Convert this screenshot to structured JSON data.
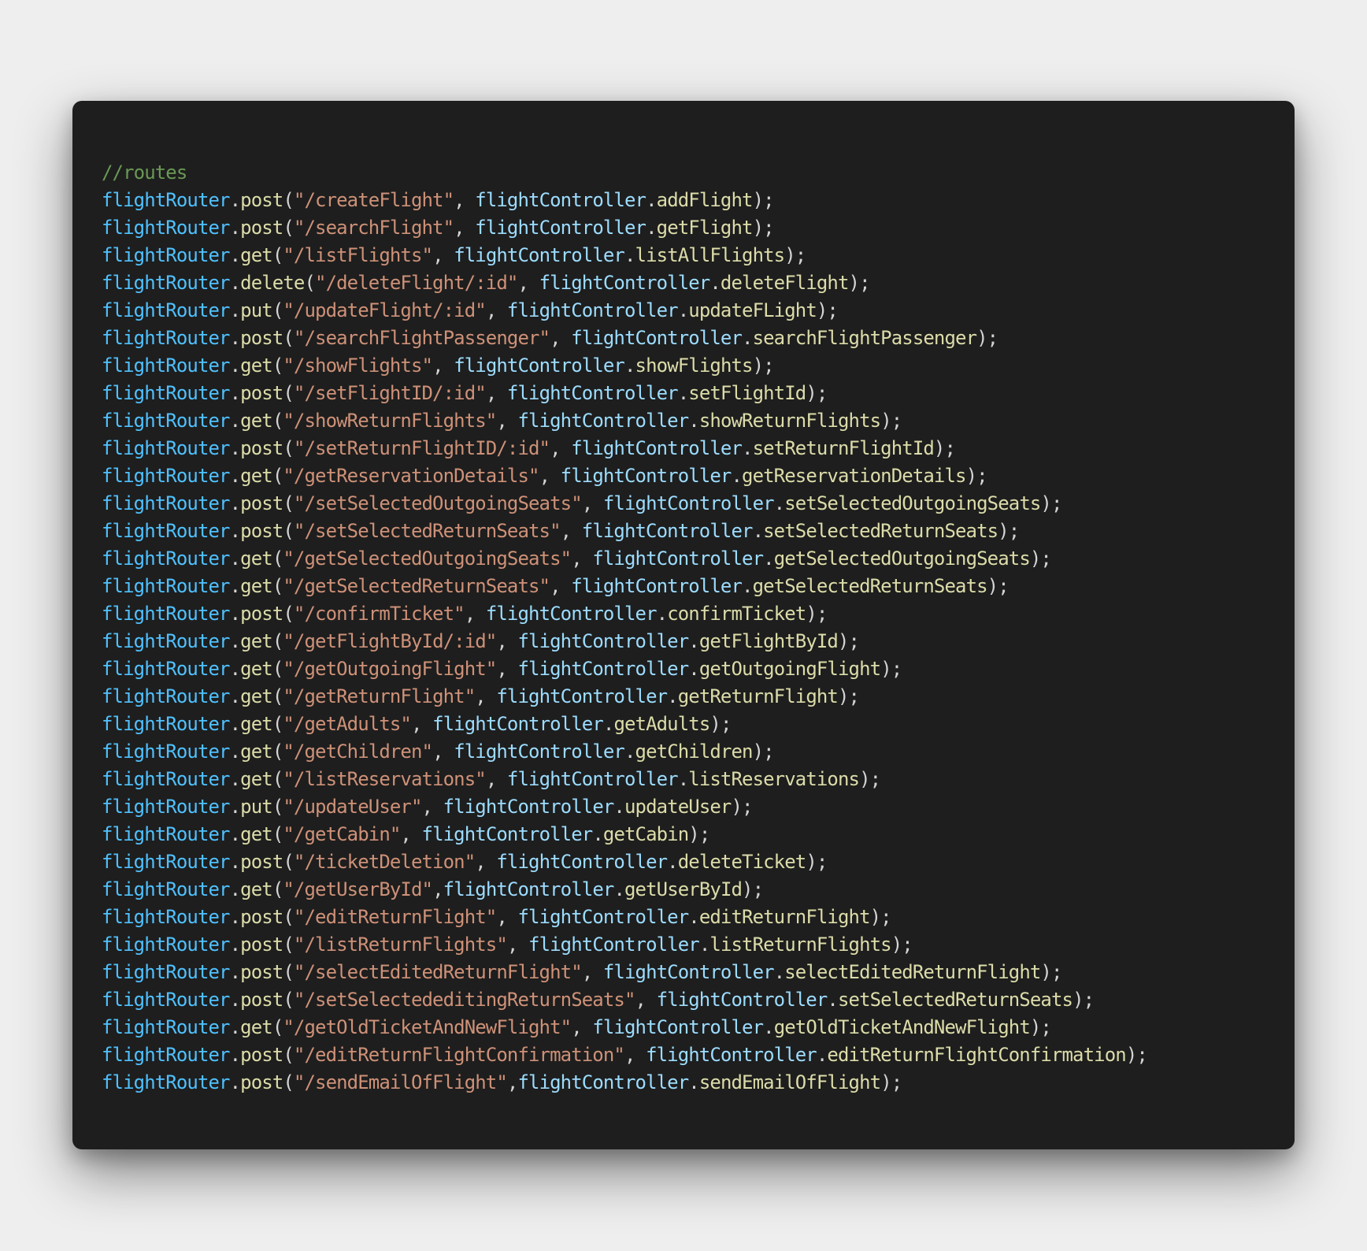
{
  "code": {
    "comment": "//routes",
    "router": "flightRouter",
    "controller": "flightController",
    "routes": [
      {
        "method": "post",
        "path": "\"/createFlight\"",
        "sep": ", ",
        "handler": "addFlight"
      },
      {
        "method": "post",
        "path": "\"/searchFlight\"",
        "sep": ", ",
        "handler": "getFlight"
      },
      {
        "method": "get",
        "path": "\"/listFlights\"",
        "sep": ", ",
        "handler": "listAllFlights"
      },
      {
        "method": "delete",
        "path": "\"/deleteFlight/:id\"",
        "sep": ", ",
        "handler": "deleteFlight"
      },
      {
        "method": "put",
        "path": "\"/updateFlight/:id\"",
        "sep": ", ",
        "handler": "updateFLight"
      },
      {
        "method": "post",
        "path": "\"/searchFlightPassenger\"",
        "sep": ", ",
        "handler": "searchFlightPassenger"
      },
      {
        "method": "get",
        "path": "\"/showFlights\"",
        "sep": ", ",
        "handler": "showFlights"
      },
      {
        "method": "post",
        "path": "\"/setFlightID/:id\"",
        "sep": ", ",
        "handler": "setFlightId"
      },
      {
        "method": "get",
        "path": "\"/showReturnFlights\"",
        "sep": ", ",
        "handler": "showReturnFlights"
      },
      {
        "method": "post",
        "path": "\"/setReturnFlightID/:id\"",
        "sep": ", ",
        "handler": "setReturnFlightId"
      },
      {
        "method": "get",
        "path": "\"/getReservationDetails\"",
        "sep": ", ",
        "handler": "getReservationDetails"
      },
      {
        "method": "post",
        "path": "\"/setSelectedOutgoingSeats\"",
        "sep": ", ",
        "handler": "setSelectedOutgoingSeats"
      },
      {
        "method": "post",
        "path": "\"/setSelectedReturnSeats\"",
        "sep": ", ",
        "handler": "setSelectedReturnSeats"
      },
      {
        "method": "get",
        "path": "\"/getSelectedOutgoingSeats\"",
        "sep": ", ",
        "handler": "getSelectedOutgoingSeats"
      },
      {
        "method": "get",
        "path": "\"/getSelectedReturnSeats\"",
        "sep": ", ",
        "handler": "getSelectedReturnSeats"
      },
      {
        "method": "post",
        "path": "\"/confirmTicket\"",
        "sep": ", ",
        "handler": "confirmTicket"
      },
      {
        "method": "get",
        "path": "\"/getFlightById/:id\"",
        "sep": ", ",
        "handler": "getFlightById"
      },
      {
        "method": "get",
        "path": "\"/getOutgoingFlight\"",
        "sep": ", ",
        "handler": "getOutgoingFlight"
      },
      {
        "method": "get",
        "path": "\"/getReturnFlight\"",
        "sep": ", ",
        "handler": "getReturnFlight"
      },
      {
        "method": "get",
        "path": "\"/getAdults\"",
        "sep": ", ",
        "handler": "getAdults"
      },
      {
        "method": "get",
        "path": "\"/getChildren\"",
        "sep": ", ",
        "handler": "getChildren"
      },
      {
        "method": "get",
        "path": "\"/listReservations\"",
        "sep": ", ",
        "handler": "listReservations"
      },
      {
        "method": "put",
        "path": "\"/updateUser\"",
        "sep": ", ",
        "handler": "updateUser"
      },
      {
        "method": "get",
        "path": "\"/getCabin\"",
        "sep": ", ",
        "handler": "getCabin"
      },
      {
        "method": "post",
        "path": "\"/ticketDeletion\"",
        "sep": ", ",
        "handler": "deleteTicket"
      },
      {
        "method": "get",
        "path": "\"/getUserById\"",
        "sep": ",",
        "handler": "getUserById"
      },
      {
        "method": "post",
        "path": "\"/editReturnFlight\"",
        "sep": ", ",
        "handler": "editReturnFlight"
      },
      {
        "method": "post",
        "path": "\"/listReturnFlights\"",
        "sep": ", ",
        "handler": "listReturnFlights"
      },
      {
        "method": "post",
        "path": "\"/selectEditedReturnFlight\"",
        "sep": ", ",
        "handler": "selectEditedReturnFlight"
      },
      {
        "method": "post",
        "path": "\"/setSelectededitingReturnSeats\"",
        "sep": ", ",
        "handler": "setSelectedReturnSeats"
      },
      {
        "method": "get",
        "path": "\"/getOldTicketAndNewFlight\"",
        "sep": ", ",
        "handler": "getOldTicketAndNewFlight"
      },
      {
        "method": "post",
        "path": "\"/editReturnFlightConfirmation\"",
        "sep": ", ",
        "handler": "editReturnFlightConfirmation"
      },
      {
        "method": "post",
        "path": "\"/sendEmailOfFlight\"",
        "sep": ",",
        "handler": "sendEmailOfFlight"
      }
    ]
  }
}
